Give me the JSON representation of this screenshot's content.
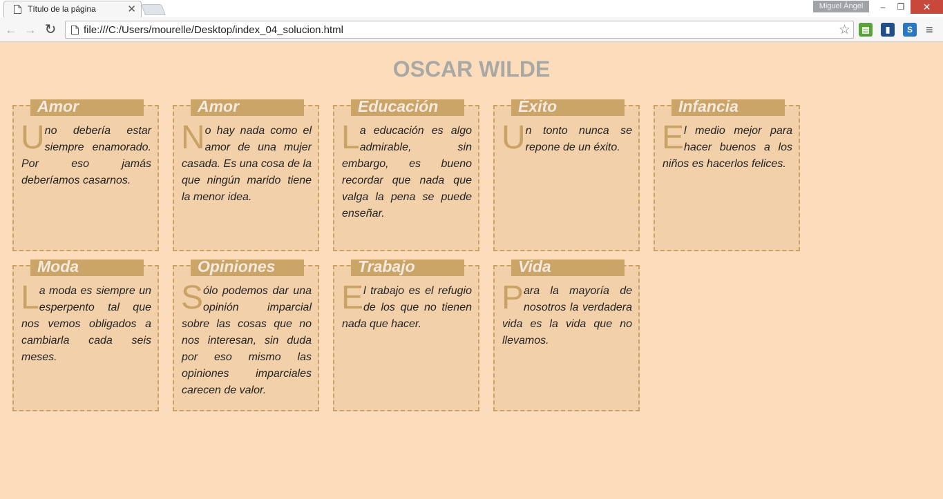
{
  "browser": {
    "tab_title": "Título de la página",
    "tab_close": "✕",
    "user_name": "Miguel Ángel",
    "url": "file:///C:/Users/mourelle/Desktop/index_04_solucion.html",
    "window_buttons": {
      "minimize": "–",
      "maximize": "❐",
      "close": "✕"
    },
    "nav": {
      "back": "←",
      "forward": "→",
      "reload": "↻",
      "bookmark": "☆",
      "menu": "≡"
    },
    "extensions": [
      {
        "icon": "printer-extension-icon",
        "glyph": "▤",
        "color": "#5aa33b"
      },
      {
        "icon": "chart-extension-icon",
        "glyph": "▮",
        "color": "#1f4e89"
      },
      {
        "icon": "s-extension-icon",
        "glyph": "S",
        "color": "#2b77c2"
      }
    ]
  },
  "page": {
    "title": "OSCAR WILDE",
    "colors": {
      "background": "#fddcbb",
      "card_background": "#f2d0aa",
      "card_border": "#c9a265",
      "heading_tab": "#cba468",
      "title": "#a8a8a4"
    },
    "cards": [
      {
        "heading": "Amor",
        "initial": "U",
        "text": "no debería estar siempre enamorado. Por eso jamás deberíamos casarnos."
      },
      {
        "heading": "Amor",
        "initial": "N",
        "text": "o hay nada como el amor de una mujer casada. Es una cosa de la que ningún marido tiene la menor idea."
      },
      {
        "heading": "Educación",
        "initial": "L",
        "text": "a educación es algo admirable, sin embargo, es bueno recordar que nada que valga la pena se puede enseñar."
      },
      {
        "heading": "Éxito",
        "initial": "U",
        "text": "n tonto nunca se repone de un éxito."
      },
      {
        "heading": "Infancia",
        "initial": "E",
        "text": "l medio mejor para hacer buenos a los niños es hacerlos felices."
      },
      {
        "heading": "Moda",
        "initial": "L",
        "text": "a moda es siempre un esperpento tal que nos vemos obligados a cambiarla cada seis meses."
      },
      {
        "heading": "Opiniones",
        "initial": "S",
        "text": "ólo podemos dar una opinión imparcial sobre las cosas que no nos interesan, sin duda por eso mismo las opiniones imparciales carecen de valor."
      },
      {
        "heading": "Trabajo",
        "initial": "E",
        "text": "l trabajo es el refugio de los que no tienen nada que hacer."
      },
      {
        "heading": "Vida",
        "initial": "P",
        "text": "ara la mayoría de nosotros la verdadera vida es la vida que no llevamos."
      }
    ]
  }
}
